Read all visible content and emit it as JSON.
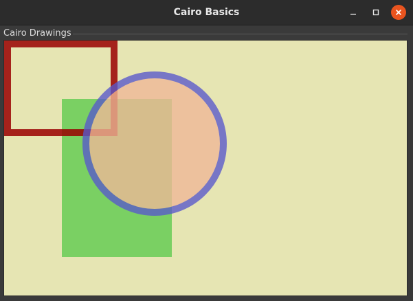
{
  "window": {
    "title": "Cairo Basics"
  },
  "frame": {
    "label": "Cairo Drawings"
  },
  "colors": {
    "canvas_bg": "#e6e5b3",
    "square_stroke": "#990000",
    "rect_fill": "#66cc55",
    "circle_fill": "#f0b898",
    "circle_stroke": "#5858cc",
    "close_button": "#e9541f"
  },
  "icons": {
    "minimize": "minimize-icon",
    "maximize": "maximize-icon",
    "close": "close-icon"
  }
}
